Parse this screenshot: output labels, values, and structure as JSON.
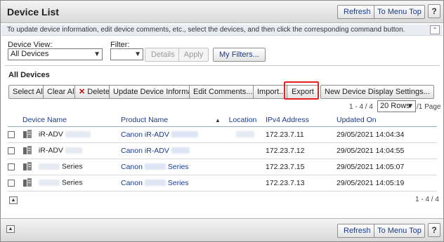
{
  "header": {
    "title": "Device List",
    "refresh_label": "Refresh",
    "to_menu_top_label": "To Menu Top",
    "help_label": "?"
  },
  "infobar": {
    "message": "To update device information, edit device comments, etc., select the devices, and then click the corresponding command button.",
    "collapse_glyph": "⌃"
  },
  "filters": {
    "device_view_label": "Device View:",
    "device_view_value": "All Devices",
    "filter_label": "Filter:",
    "filter_value": "",
    "details_label": "Details",
    "apply_label": "Apply",
    "my_filters_label": "My Filters..."
  },
  "section": {
    "title": "All Devices"
  },
  "toolbar": {
    "select_all_label": "Select All",
    "clear_all_label": "Clear All",
    "delete_label": "Delete",
    "update_info_label": "Update Device Information",
    "edit_comments_label": "Edit Comments...",
    "import_label": "Import...",
    "export_label": "Export",
    "new_display_settings_label": "New Device Display Settings..."
  },
  "paging": {
    "range_text": "1 - 4 / 4",
    "rows_value": "20 Rows",
    "pages_text": "/1 Page",
    "bottom_range_text": "1 - 4 / 4"
  },
  "table": {
    "columns": [
      "Device Name",
      "Product Name",
      "Location",
      "IPv4 Address",
      "Updated On"
    ],
    "rows": [
      {
        "device_prefix": "iR-ADV",
        "device_suffix": "",
        "product_prefix": "Canon iR-ADV",
        "product_suffix": "",
        "ip": "172.23.7.11",
        "updated": "29/05/2021 14:04:34"
      },
      {
        "device_prefix": "iR-ADV",
        "device_suffix": "",
        "product_prefix": "Canon iR-ADV",
        "product_suffix": "",
        "ip": "172.23.7.12",
        "updated": "29/05/2021 14:04:55"
      },
      {
        "device_prefix": "",
        "device_suffix": "Series",
        "product_prefix": "Canon",
        "product_suffix": "Series",
        "ip": "172.23.7.15",
        "updated": "29/05/2021 14:05:07"
      },
      {
        "device_prefix": "",
        "device_suffix": "Series",
        "product_prefix": "Canon",
        "product_suffix": "Series",
        "ip": "172.23.7.13",
        "updated": "29/05/2021 14:05:19"
      }
    ]
  },
  "footer": {
    "refresh_label": "Refresh",
    "to_menu_top_label": "To Menu Top",
    "help_label": "?"
  },
  "colors": {
    "link": "#1a3a8a",
    "highlight": "#e32121"
  }
}
